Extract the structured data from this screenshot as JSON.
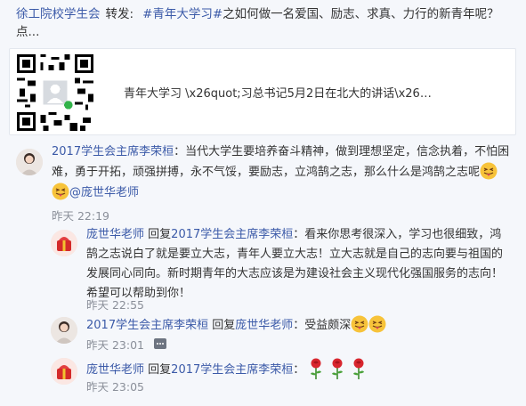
{
  "post": {
    "author": "徐工院校学生会",
    "repost_label": "转发:",
    "topic": "#青年大学习#",
    "text": "之如何做一名爱国、励志、求真、力行的新青年呢？点..."
  },
  "card": {
    "title": "青年大学习 \\x26quot;习总书记5月2日在北大的讲话\\x26…",
    "icon": "qr-code-icon"
  },
  "comments": [
    {
      "author": "2017学生会主席李荣桓",
      "text_line1": "：当代大学生要培养奋斗精神，做到理想坚定，信念执着，不怕困",
      "text_line2": "难，勇于开拓，顽强拼搏，永不气馁，要励志，立鸿鹄之志，那么什么是鸿鹄之志呢",
      "mention": "@庞世华老师",
      "time": "昨天 22:19"
    },
    {
      "author": "庞世华老师",
      "reply_label": "回复",
      "reply_to": "2017学生会主席李荣桓",
      "text_line1": "：看来你思考很深入，学习也很细致，鸿",
      "text_line2": "鹄之志说白了就是要立大志，青年人要立大志！立大志就是自己的志向要与祖国的",
      "text_line3": "发展同心同向。新时期青年的大志应该是为建设社会主义现代化强国服务的志向！",
      "text_line4": "希望可以帮助到你！",
      "time": "昨天 22:55"
    },
    {
      "author": "2017学生会主席李荣桓",
      "reply_label": "回复",
      "reply_to": "庞世华老师",
      "text": "：受益颇深",
      "time": "昨天 23:01"
    },
    {
      "author": "庞世华老师",
      "reply_label": "回复",
      "reply_to": "2017学生会主席李荣桓",
      "text": "：",
      "time": "昨天 23:05"
    }
  ],
  "colors": {
    "link": "#3b5aa8",
    "time": "#8a8f99",
    "background": "#f5f7fb"
  }
}
